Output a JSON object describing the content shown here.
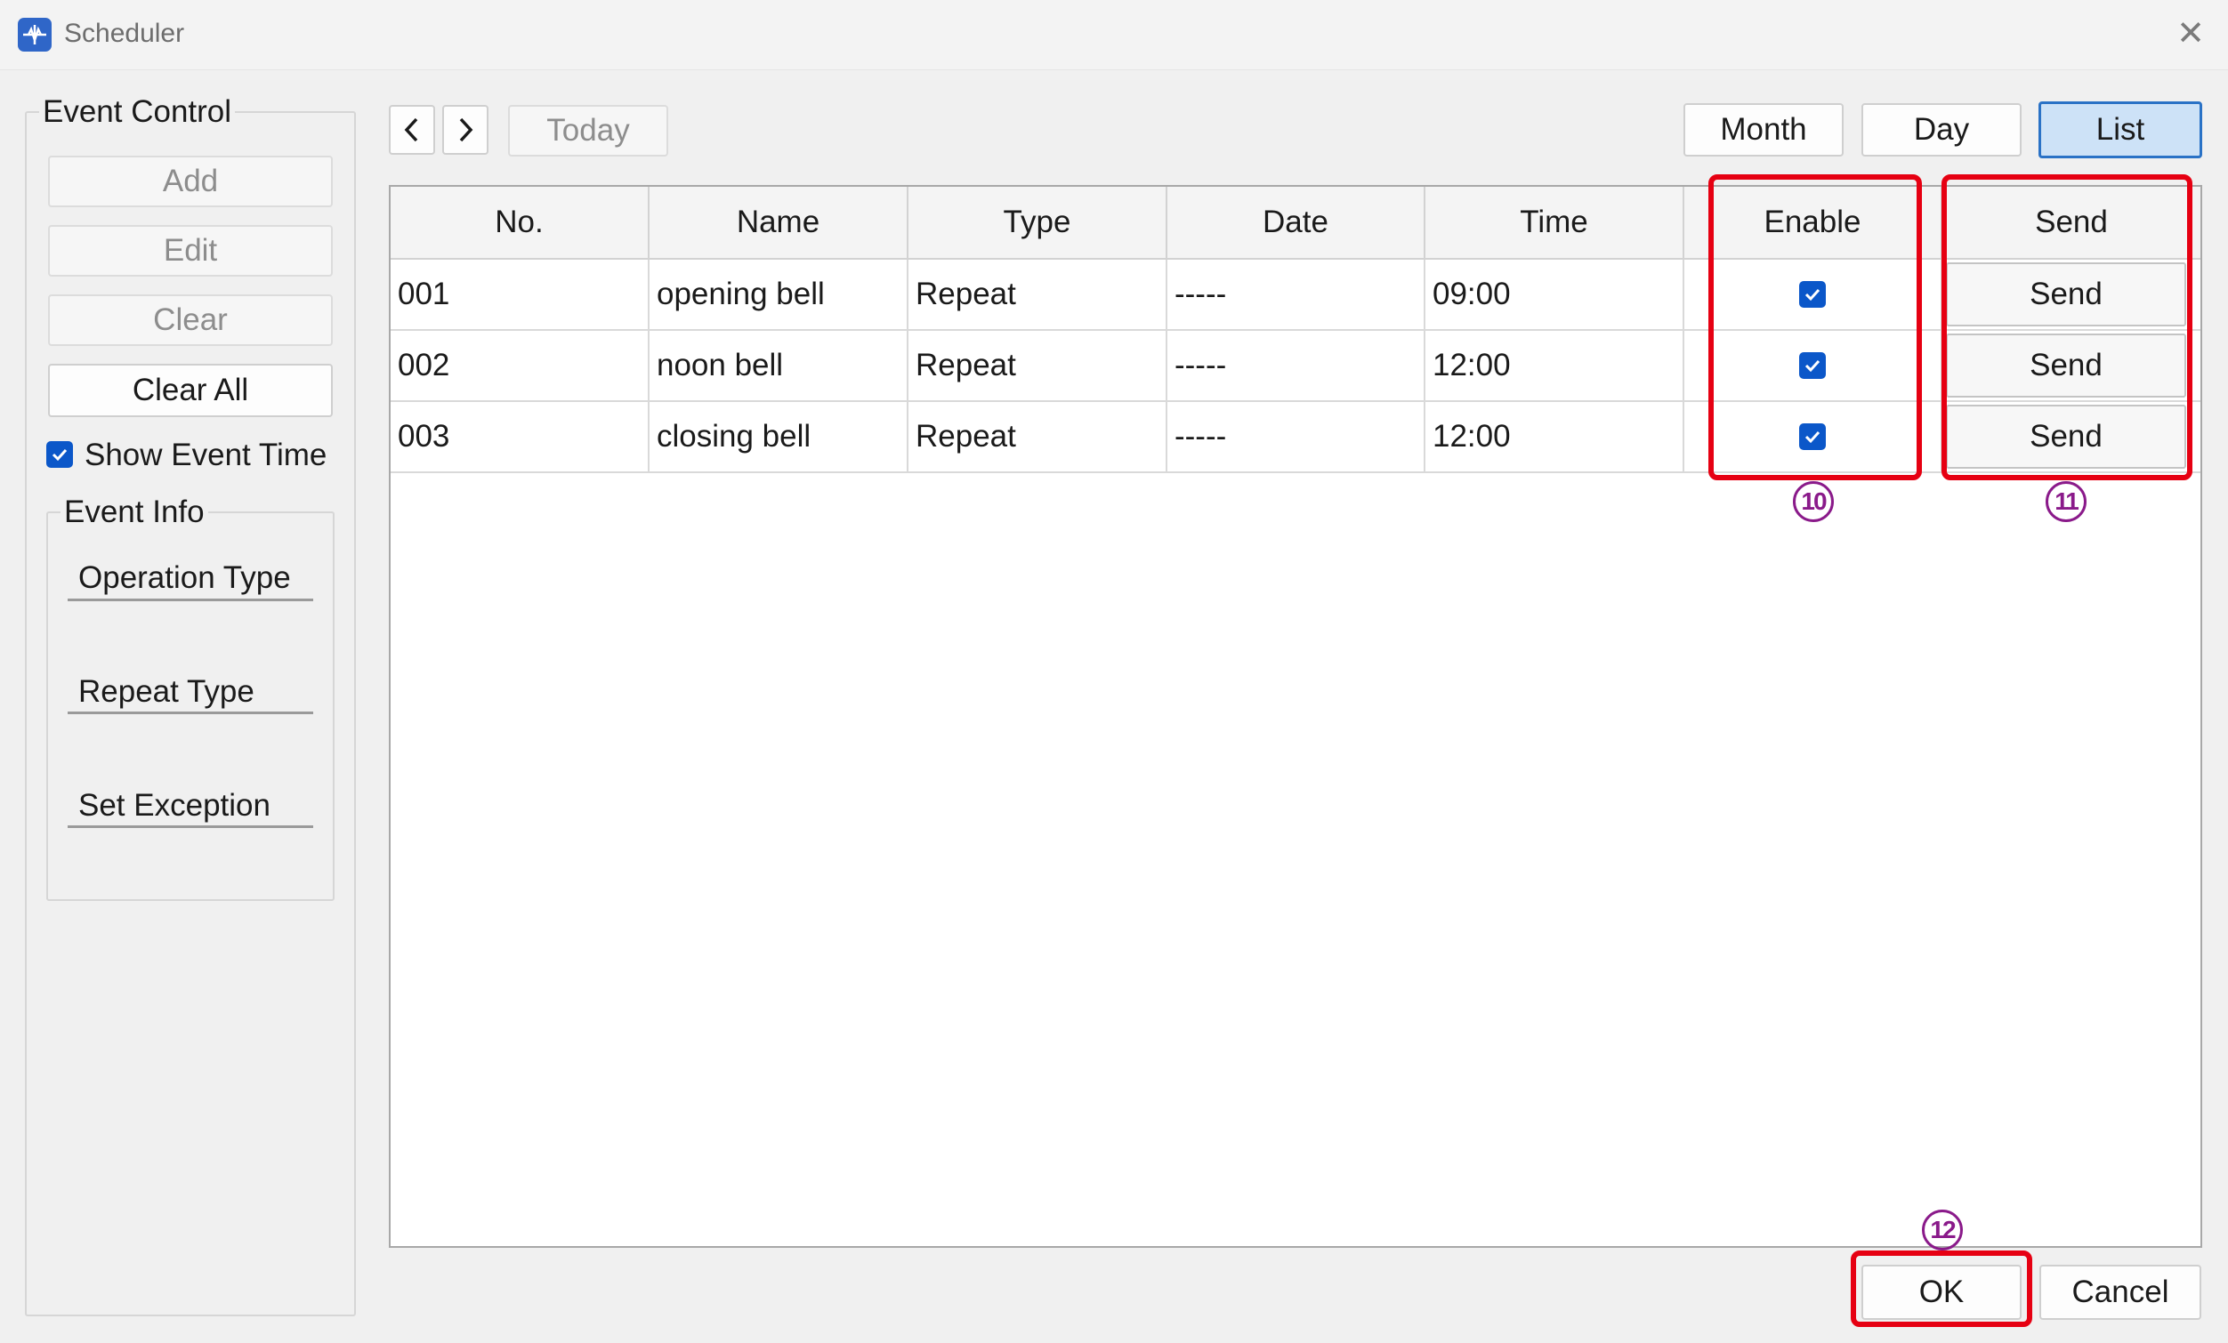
{
  "window": {
    "title": "Scheduler"
  },
  "icons": {
    "app": "scheduler-app-icon",
    "close": "close-icon",
    "prev": "chevron-left-icon",
    "next": "chevron-right-icon",
    "check": "checkmark-icon"
  },
  "colors": {
    "accent": "#0b57c9",
    "annotation_red": "#e60012",
    "callout_purple": "#8a1a8a",
    "selected_view_bg": "#cde2f7"
  },
  "event_control": {
    "title": "Event Control",
    "add": "Add",
    "edit": "Edit",
    "clear": "Clear",
    "clear_all": "Clear All",
    "show_event_time": {
      "label": "Show Event Time",
      "checked": true
    }
  },
  "event_info": {
    "title": "Event Info",
    "operation_type": "Operation Type",
    "repeat_type": "Repeat Type",
    "set_exception": "Set Exception"
  },
  "toolbar": {
    "prev_glyph": "‹",
    "next_glyph": "›",
    "today": "Today",
    "views": [
      "Month",
      "Day",
      "List"
    ],
    "selected_view": "List"
  },
  "table": {
    "headers": [
      "No.",
      "Name",
      "Type",
      "Date",
      "Time",
      "Enable",
      "Send"
    ],
    "rows": [
      {
        "no": "001",
        "name": "opening bell",
        "type": "Repeat",
        "date": "-----",
        "time": "09:00",
        "enable": true,
        "send": "Send"
      },
      {
        "no": "002",
        "name": "noon bell",
        "type": "Repeat",
        "date": "-----",
        "time": "12:00",
        "enable": true,
        "send": "Send"
      },
      {
        "no": "003",
        "name": "closing bell",
        "type": "Repeat",
        "date": "-----",
        "time": "12:00",
        "enable": true,
        "send": "Send"
      }
    ]
  },
  "callouts": {
    "enable": "10",
    "send": "11",
    "ok": "12"
  },
  "footer": {
    "ok": "OK",
    "cancel": "Cancel"
  }
}
